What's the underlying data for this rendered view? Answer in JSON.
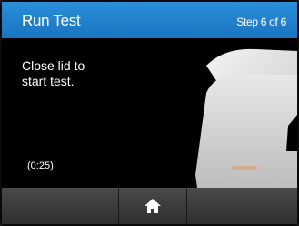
{
  "header": {
    "title": "Run Test",
    "step": "Step 6 of 6"
  },
  "content": {
    "instruction": "Close lid to\nstart test.",
    "timer": "(0:25)"
  },
  "footer": {
    "home_icon": "home-icon"
  },
  "colors": {
    "header_blue": "#1b74c1",
    "background": "#000000",
    "footer_gray": "#3a3a3a"
  }
}
